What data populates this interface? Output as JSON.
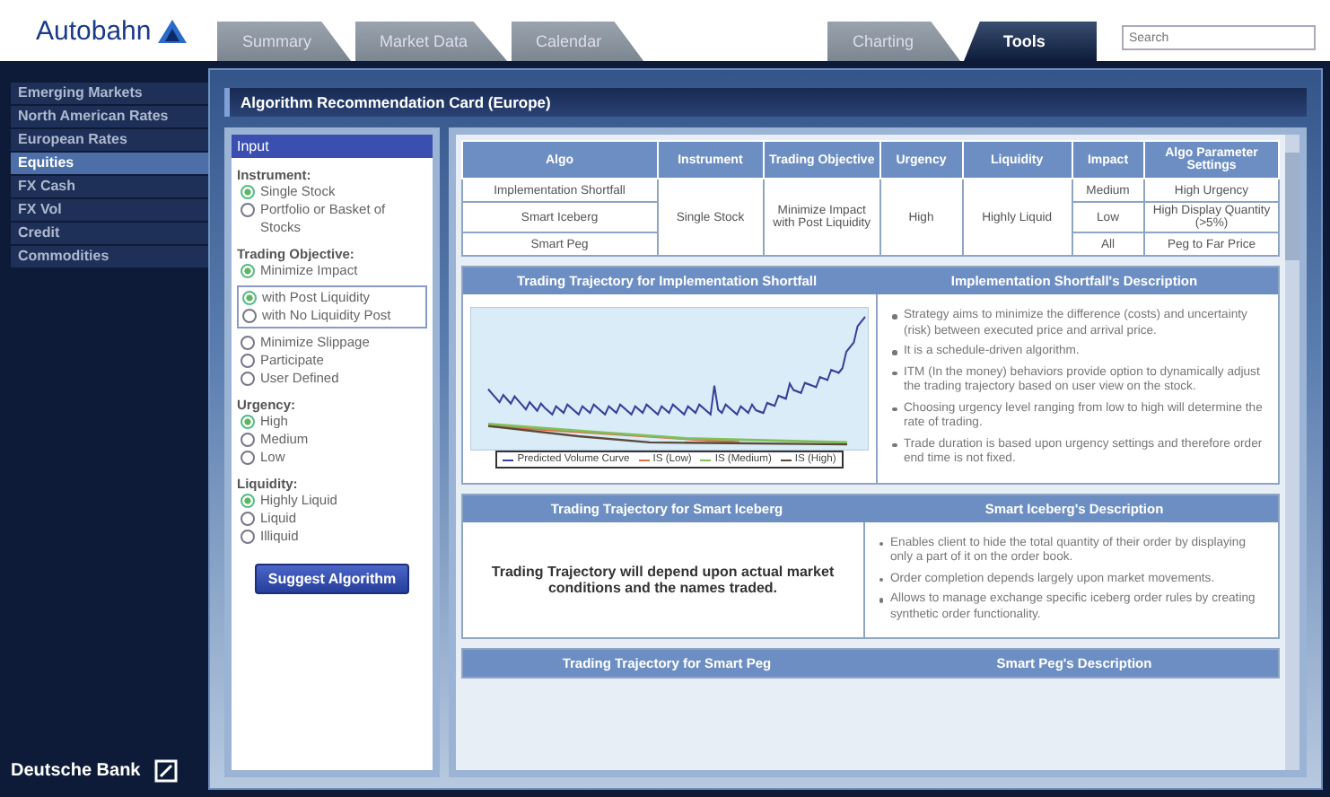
{
  "header": {
    "logo": "Autobahn",
    "search": {
      "placeholder": "Search"
    }
  },
  "tabs": {
    "left": [
      {
        "label": "Summary",
        "selected": false
      },
      {
        "label": "Market Data",
        "selected": false
      },
      {
        "label": "Calendar",
        "selected": false
      }
    ],
    "right": [
      {
        "label": "Charting",
        "selected": false
      },
      {
        "label": "Tools",
        "selected": true
      }
    ]
  },
  "sidebar": {
    "items": [
      {
        "label": "Emerging Markets",
        "selected": false
      },
      {
        "label": "North American Rates",
        "selected": false
      },
      {
        "label": "European Rates",
        "selected": false
      },
      {
        "label": "Equities",
        "selected": true
      },
      {
        "label": "FX Cash",
        "selected": false
      },
      {
        "label": "FX Vol",
        "selected": false
      },
      {
        "label": "Credit",
        "selected": false
      },
      {
        "label": "Commodities",
        "selected": false
      }
    ],
    "footer": "Deutsche Bank"
  },
  "panel_title": "Algorithm Recommendation Card (Europe)",
  "input": {
    "title": "Input",
    "groups": [
      {
        "label": "Instrument:",
        "options": [
          {
            "label": "Single Stock",
            "selected": true
          },
          {
            "label": "Portfolio or Basket of Stocks",
            "selected": false
          }
        ]
      },
      {
        "label": "Trading Objective:",
        "options": [
          {
            "label": "Minimize Impact",
            "selected": true,
            "kind": "plain"
          },
          {
            "label": "with Post Liquidity",
            "selected": true,
            "kind": "sub"
          },
          {
            "label": "with No Liquidity Post",
            "selected": false,
            "kind": "sub"
          },
          {
            "label": "Minimize Slippage",
            "selected": false,
            "kind": "plain"
          },
          {
            "label": "Participate",
            "selected": false,
            "kind": "plain"
          },
          {
            "label": "User Defined",
            "selected": false,
            "kind": "plain"
          }
        ]
      },
      {
        "label": "Urgency:",
        "options": [
          {
            "label": "High",
            "selected": true
          },
          {
            "label": "Medium",
            "selected": false
          },
          {
            "label": "Low",
            "selected": false
          }
        ]
      },
      {
        "label": "Liquidity:",
        "options": [
          {
            "label": "Highly Liquid",
            "selected": true
          },
          {
            "label": "Liquid",
            "selected": false
          },
          {
            "label": "Illiquid",
            "selected": false
          }
        ]
      }
    ],
    "button": "Suggest Algorithm"
  },
  "table": {
    "columns": [
      "Algo",
      "Instrument",
      "Trading Objective",
      "Urgency",
      "Liquidity",
      "Impact",
      "Algo Parameter Settings"
    ],
    "shared": {
      "instrument": "Single Stock",
      "trading_objective": "Minimize Impact with Post Liquidity",
      "urgency": "High",
      "liquidity": "Highly Liquid"
    },
    "rows": [
      {
        "algo": "Implementation Shortfall",
        "impact": "Medium",
        "parameters": "High Urgency"
      },
      {
        "algo": "Smart Iceberg",
        "impact": "Low",
        "parameters": "High Display Quantity (>5%)"
      },
      {
        "algo": "Smart Peg",
        "impact": "All",
        "parameters": "Peg to Far Price"
      }
    ]
  },
  "sections": [
    {
      "kind": "chart",
      "trajectory_title": "Trading Trajectory for Implementation Shortfall",
      "description_title": "Implementation Shortfall's Description",
      "legend": [
        {
          "label": "Predicted Volume Curve",
          "color": "#3a3f9a"
        },
        {
          "label": "IS (Low)",
          "color": "#e06a4a"
        },
        {
          "label": "IS (Medium)",
          "color": "#7fbf5a"
        },
        {
          "label": "IS (High)",
          "color": "#5a4a3a"
        }
      ],
      "bullets": [
        "Strategy aims to minimize the difference (costs) and uncertainty (risk) between executed price and arrival price.",
        "It is a schedule-driven algorithm.",
        "ITM (In the money) behaviors provide option to dynamically adjust the trading trajectory based on user view on the stock.",
        "Choosing urgency level ranging from low to high will determine the rate of trading.",
        "Trade duration is based upon urgency settings and therefore order end time is not fixed."
      ]
    },
    {
      "kind": "note",
      "trajectory_title": "Trading Trajectory for Smart Iceberg",
      "description_title": "Smart Iceberg's Description",
      "note": "Trading Trajectory will depend upon actual market conditions and the names traded.",
      "bullets": [
        "Enables client to hide the total quantity of their order by displaying only a part of it on the order book.",
        "Order completion depends largely upon market movements.",
        "Allows to manage exchange specific iceberg order rules by creating synthetic order functionality."
      ]
    },
    {
      "kind": "collapsed",
      "trajectory_title": "Trading Trajectory for Smart Peg",
      "description_title": "Smart Peg's Description"
    }
  ]
}
